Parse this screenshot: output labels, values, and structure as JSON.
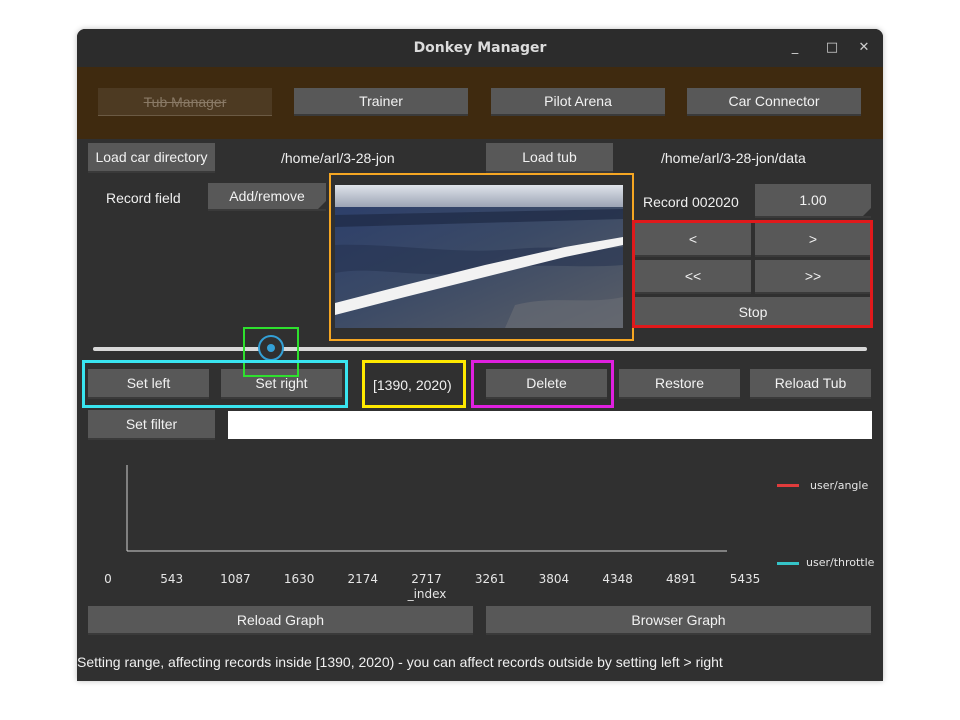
{
  "window": {
    "title": "Donkey Manager",
    "controls": {
      "minimize": "_",
      "maximize": "□",
      "close": "✕"
    }
  },
  "nav": {
    "tabs": [
      {
        "label": "Tub Manager",
        "state": "disabled"
      },
      {
        "label": "Trainer"
      },
      {
        "label": "Pilot Arena"
      },
      {
        "label": "Car Connector"
      }
    ]
  },
  "car": {
    "load_car_label": "Load car directory",
    "car_path": "/home/arl/3-28-jon",
    "load_tub_label": "Load tub",
    "tub_path": "/home/arl/3-28-jon/data"
  },
  "record": {
    "field_label": "Record field",
    "add_remove_label": "Add/remove",
    "record_label": "Record 002020",
    "speed_value": "1.00"
  },
  "playback": {
    "step_back": "<",
    "step_forward": ">",
    "fast_back": "<<",
    "fast_forward": ">>",
    "stop": "Stop"
  },
  "slider": {
    "fraction": 0.23
  },
  "range": {
    "set_left": "Set left",
    "set_right": "Set right",
    "range_text": "[1390, 2020)",
    "delete": "Delete",
    "restore": "Restore",
    "reload_tub": "Reload Tub"
  },
  "filter": {
    "set_filter": "Set filter",
    "value": "",
    "placeholder": ""
  },
  "chart_data": {
    "type": "line",
    "x_ticks": [
      "0",
      "543",
      "1087",
      "1630",
      "2174",
      "2717",
      "3261",
      "3804",
      "4348",
      "4891",
      "5435"
    ],
    "xlabel": "_index",
    "legend_position": "right",
    "series": [
      {
        "name": "user/angle",
        "color": "#e03c3c",
        "values": []
      },
      {
        "name": "user/throttle",
        "color": "#35c4c8",
        "values": []
      }
    ]
  },
  "graph_buttons": {
    "reload_graph": "Reload Graph",
    "browser_graph": "Browser Graph"
  },
  "status": {
    "text": "Setting range, affecting records inside [1390, 2020) - you can affect records outside by setting left > right"
  },
  "highlight_colors": {
    "image": "#f5a623",
    "playback": "#e0191b",
    "slider_thumb": "#2ee02e",
    "set_buttons": "#39e5f0",
    "range": "#ffe900",
    "delete": "#e020e0"
  }
}
